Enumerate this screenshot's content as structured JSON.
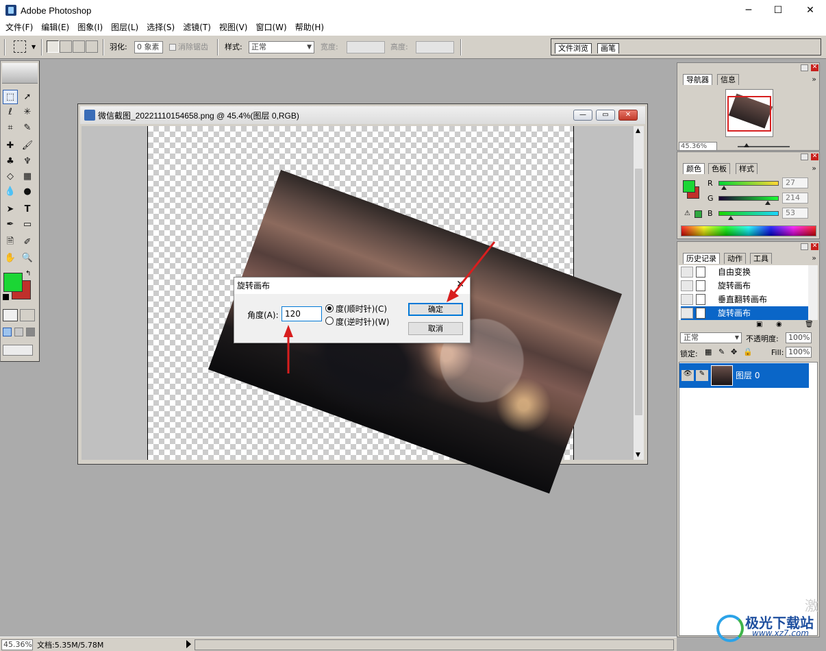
{
  "app": {
    "title": "Adobe Photoshop"
  },
  "window_controls": {
    "minimize": "─",
    "maximize": "☐",
    "close": "✕"
  },
  "menu": [
    "文件(F)",
    "编辑(E)",
    "图象(I)",
    "图层(L)",
    "选择(S)",
    "滤镜(T)",
    "视图(V)",
    "窗口(W)",
    "帮助(H)"
  ],
  "options": {
    "feather_label": "羽化:",
    "feather_value": "0 象素",
    "antialias_label": "消除锯齿",
    "style_label": "样式:",
    "style_value": "正常",
    "width_label": "宽度:",
    "height_label": "高度:"
  },
  "palette_well": {
    "tabs": [
      "文件浏览",
      "画笔"
    ]
  },
  "document": {
    "title": "微信截图_20221110154658.png @ 45.4%(图层 0,RGB)",
    "buttons": {
      "minimize": "—",
      "restore": "▭",
      "close": "✕"
    }
  },
  "dialog": {
    "title": "旋转画布",
    "close": "✕",
    "angle_label": "角度(A):",
    "angle_value": "120",
    "cw_label": "度(顺时针)(C)",
    "ccw_label": "度(逆时针)(W)",
    "selected_direction": "cw",
    "ok_label": "确定",
    "cancel_label": "取消"
  },
  "navigator": {
    "tabs": [
      "导航器",
      "信息"
    ],
    "zoom_value": "45.36%"
  },
  "color": {
    "tabs": [
      "颜色",
      "色板",
      "样式"
    ],
    "channels": [
      {
        "label": "R",
        "value": "27"
      },
      {
        "label": "G",
        "value": "214"
      },
      {
        "label": "B",
        "value": "53"
      }
    ],
    "foreground": "#1bd635",
    "background": "#c0302b"
  },
  "history": {
    "tabs": [
      "历史记录",
      "动作",
      "工具"
    ],
    "items": [
      "自由变换",
      "旋转画布",
      "垂直翻转画布",
      "旋转画布"
    ],
    "selected_index": 3
  },
  "layers": {
    "blend_mode": "正常",
    "opacity_label": "不透明度:",
    "opacity_value": "100%",
    "lock_label": "锁定:",
    "fill_label": "Fill:",
    "fill_value": "100%",
    "layer_name": "图层 0"
  },
  "status": {
    "zoom": "45.36%",
    "doc_info": "文档:5.35M/5.78M"
  },
  "watermark": {
    "brand": "极光下载站",
    "url": "www.xz7.com",
    "ghost": "激"
  }
}
